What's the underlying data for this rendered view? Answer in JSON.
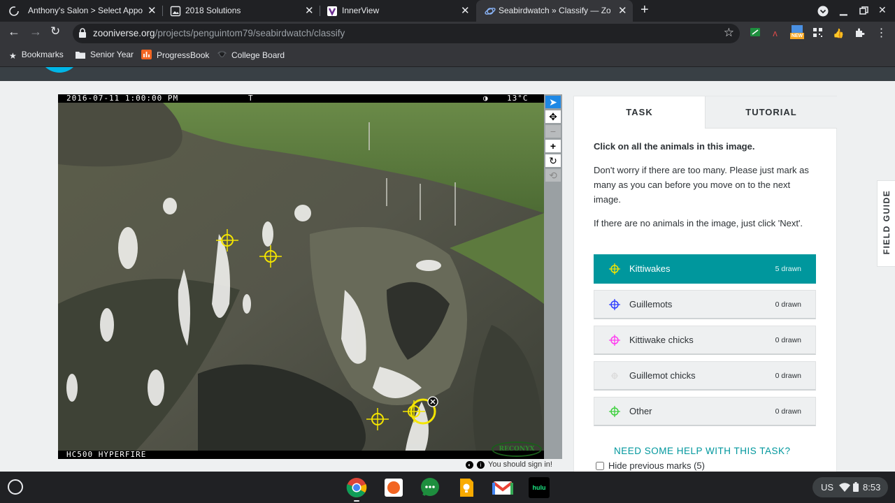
{
  "browser": {
    "tabs": [
      {
        "title": "Anthony's Salon > Select Appoin",
        "icon": "loading-spinner-icon",
        "active": false
      },
      {
        "title": "2018 Solutions",
        "icon": "image-document-icon",
        "active": false
      },
      {
        "title": "InnerView",
        "icon": "innerview-logo-icon",
        "active": false
      },
      {
        "title": "Seabirdwatch » Classify — Zooni",
        "icon": "zooniverse-icon",
        "active": true
      }
    ],
    "url_domain": "zooniverse.org",
    "url_path": "/projects/penguintom79/seabirdwatch/classify",
    "extension_badge": "NEW",
    "bookmarks": [
      {
        "label": "Bookmarks",
        "icon": "star-icon"
      },
      {
        "label": "Senior Year",
        "icon": "folder-icon"
      },
      {
        "label": "ProgressBook",
        "icon": "progressbook-icon"
      },
      {
        "label": "College Board",
        "icon": "acorn-icon"
      }
    ]
  },
  "subject": {
    "timestamp": "2016-07-11  1:00:00 PM",
    "moon": "T",
    "temperature": "13°C",
    "camera": "HC500 HYPERFIRE",
    "watermark": "RECONYX",
    "marks_color": "#f4e500"
  },
  "sign_in_notice": "You should sign in!",
  "task_panel": {
    "tabs": [
      {
        "label": "TASK"
      },
      {
        "label": "TUTORIAL"
      }
    ],
    "instruction_title": "Click on all the animals in this image.",
    "instruction_body": "Don't worry if there are too many. Please just mark as many as you can before you move on to the next image.",
    "instruction_none": "If there are no animals in the image, just click 'Next'.",
    "tools": [
      {
        "label": "Kittiwakes",
        "count": "5 drawn",
        "color": "#f4e500",
        "selected": true
      },
      {
        "label": "Guillemots",
        "count": "0 drawn",
        "color": "#2e3cff",
        "selected": false
      },
      {
        "label": "Kittiwake chicks",
        "count": "0 drawn",
        "color": "#ff3cf0",
        "selected": false
      },
      {
        "label": "Guillemot chicks",
        "count": "0 drawn",
        "color": "#dddddd",
        "selected": false
      },
      {
        "label": "Other",
        "count": "0 drawn",
        "color": "#3cd03c",
        "selected": false
      }
    ],
    "help_link": "NEED SOME HELP WITH THIS TASK?",
    "hide_marks": "Hide previous marks (5)"
  },
  "field_guide": "FIELD GUIDE",
  "shelf": {
    "apps": [
      "chrome-icon",
      "orange-app-icon",
      "messages-icon",
      "keep-icon",
      "gmail-icon",
      "hulu-icon"
    ],
    "hulu_label": "hulu",
    "locale": "US",
    "time": "8:53"
  }
}
